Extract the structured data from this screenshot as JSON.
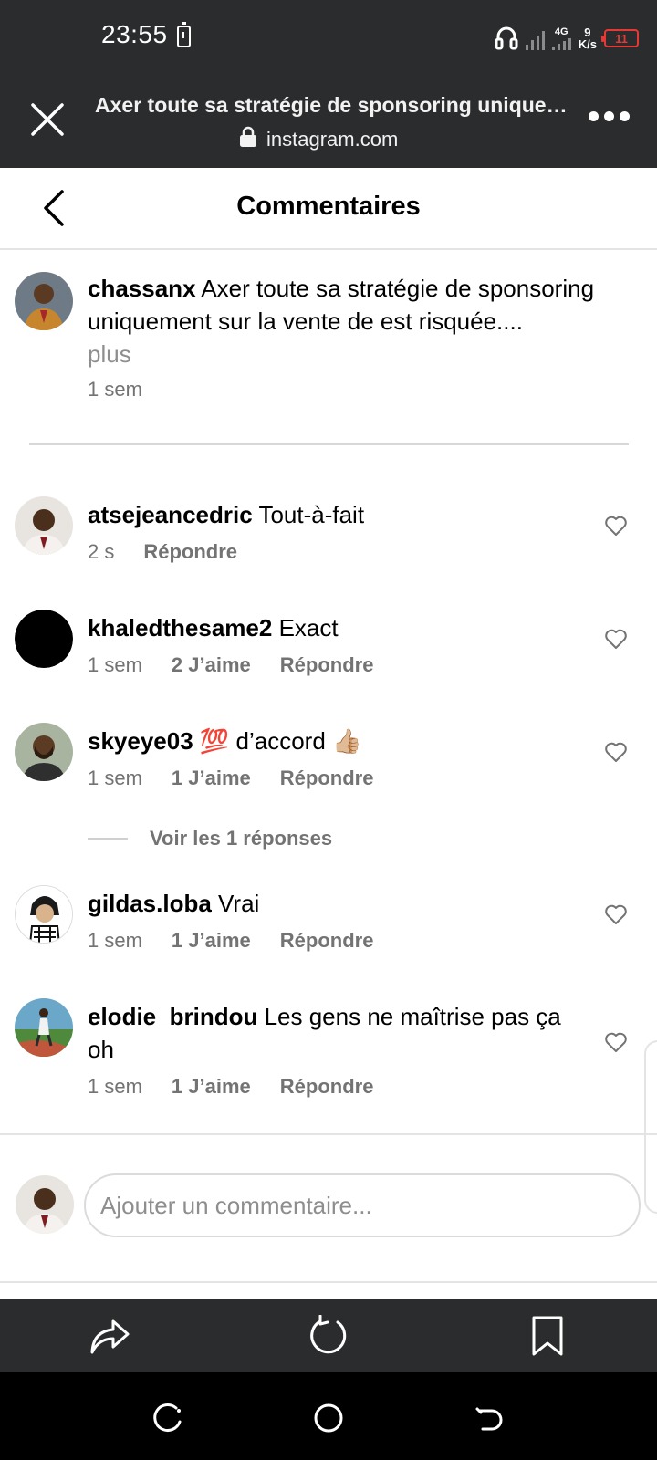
{
  "status_bar": {
    "time": "23:55",
    "network": "4G",
    "speed_value": "9",
    "speed_unit": "K/s",
    "battery": "11",
    "battery_color": "#e53935"
  },
  "browser": {
    "title": "Axer toute sa stratégie de sponsoring uniquement sur la vente de est risquée....",
    "url": "instagram.com",
    "icons": {
      "close": "close-icon",
      "lock": "lock-icon",
      "more": "more-icon"
    }
  },
  "header": {
    "title": "Commentaires",
    "back_icon": "chevron-left-icon"
  },
  "caption": {
    "username": "chassanx",
    "text": "Axer toute sa stratégie de sponsoring uniquement sur la vente de est risquée....",
    "more": "plus",
    "time": "1 sem"
  },
  "comments": [
    {
      "username": "atsejeancedric",
      "text": "Tout-à-fait",
      "time": "2 s",
      "likes": "",
      "reply": "Répondre"
    },
    {
      "username": "khaledthesame2",
      "text": "Exact",
      "time": "1 sem",
      "likes": "2 J’aime",
      "reply": "Répondre"
    },
    {
      "username": "skyeye03",
      "text": "💯 d’accord 👍🏼",
      "time": "1 sem",
      "likes": "1 J’aime",
      "reply": "Répondre"
    },
    {
      "username": "gildas.loba",
      "text": "Vrai",
      "time": "1 sem",
      "likes": "1 J’aime",
      "reply": "Répondre"
    },
    {
      "username": "elodie_brindou",
      "text": "Les gens ne maîtrise pas ça oh",
      "time": "1 sem",
      "likes": "1 J’aime",
      "reply": "Répondre"
    }
  ],
  "replies_link": "Voir les 1 réponses",
  "input": {
    "placeholder": "Ajouter un commentaire..."
  },
  "toolbar": {
    "icons": [
      "share-icon",
      "reload-icon",
      "bookmark-icon"
    ]
  },
  "navbar": {
    "icons": [
      "recent-apps-icon",
      "home-icon",
      "back-icon"
    ]
  }
}
